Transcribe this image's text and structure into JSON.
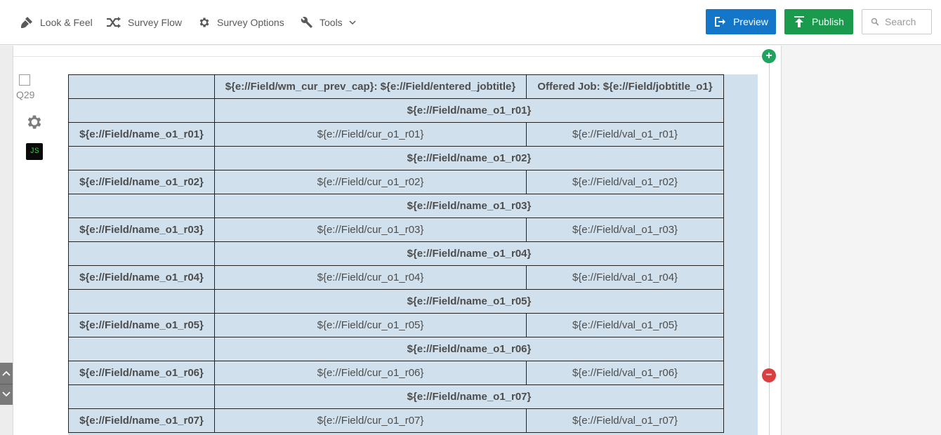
{
  "toolbar": {
    "look_feel": "Look & Feel",
    "survey_flow": "Survey Flow",
    "survey_options": "Survey Options",
    "tools": "Tools",
    "preview": "Preview",
    "publish": "Publish",
    "search_placeholder": "Search"
  },
  "colors": {
    "preview": "#1476c9",
    "publish": "#1a9a4c",
    "add": "#1fa35e",
    "remove": "#d93f3f",
    "table_bg": "#d0e0ec"
  },
  "question": {
    "id": "Q29",
    "js_badge": "JS",
    "add_symbol": "+",
    "remove_symbol": "−",
    "header": [
      "",
      "${e://Field/wm_cur_prev_cap}: ${e://Field/entered_jobtitle}",
      "Offered Job: ${e://Field/jobtitle_o1}"
    ],
    "rows": [
      {
        "group": "${e://Field/name_o1_r01}",
        "label": "${e://Field/name_o1_r01}",
        "cur": "${e://Field/cur_o1_r01}",
        "val": "${e://Field/val_o1_r01}"
      },
      {
        "group": "${e://Field/name_o1_r02}",
        "label": "${e://Field/name_o1_r02}",
        "cur": "${e://Field/cur_o1_r02}",
        "val": "${e://Field/val_o1_r02}"
      },
      {
        "group": "${e://Field/name_o1_r03}",
        "label": "${e://Field/name_o1_r03}",
        "cur": "${e://Field/cur_o1_r03}",
        "val": "${e://Field/val_o1_r03}"
      },
      {
        "group": "${e://Field/name_o1_r04}",
        "label": "${e://Field/name_o1_r04}",
        "cur": "${e://Field/cur_o1_r04}",
        "val": "${e://Field/val_o1_r04}"
      },
      {
        "group": "${e://Field/name_o1_r05}",
        "label": "${e://Field/name_o1_r05}",
        "cur": "${e://Field/cur_o1_r05}",
        "val": "${e://Field/val_o1_r05}"
      },
      {
        "group": "${e://Field/name_o1_r06}",
        "label": "${e://Field/name_o1_r06}",
        "cur": "${e://Field/cur_o1_r06}",
        "val": "${e://Field/val_o1_r06}"
      },
      {
        "group": "${e://Field/name_o1_r07}",
        "label": "${e://Field/name_o1_r07}",
        "cur": "${e://Field/cur_o1_r07}",
        "val": "${e://Field/val_o1_r07}"
      }
    ]
  }
}
